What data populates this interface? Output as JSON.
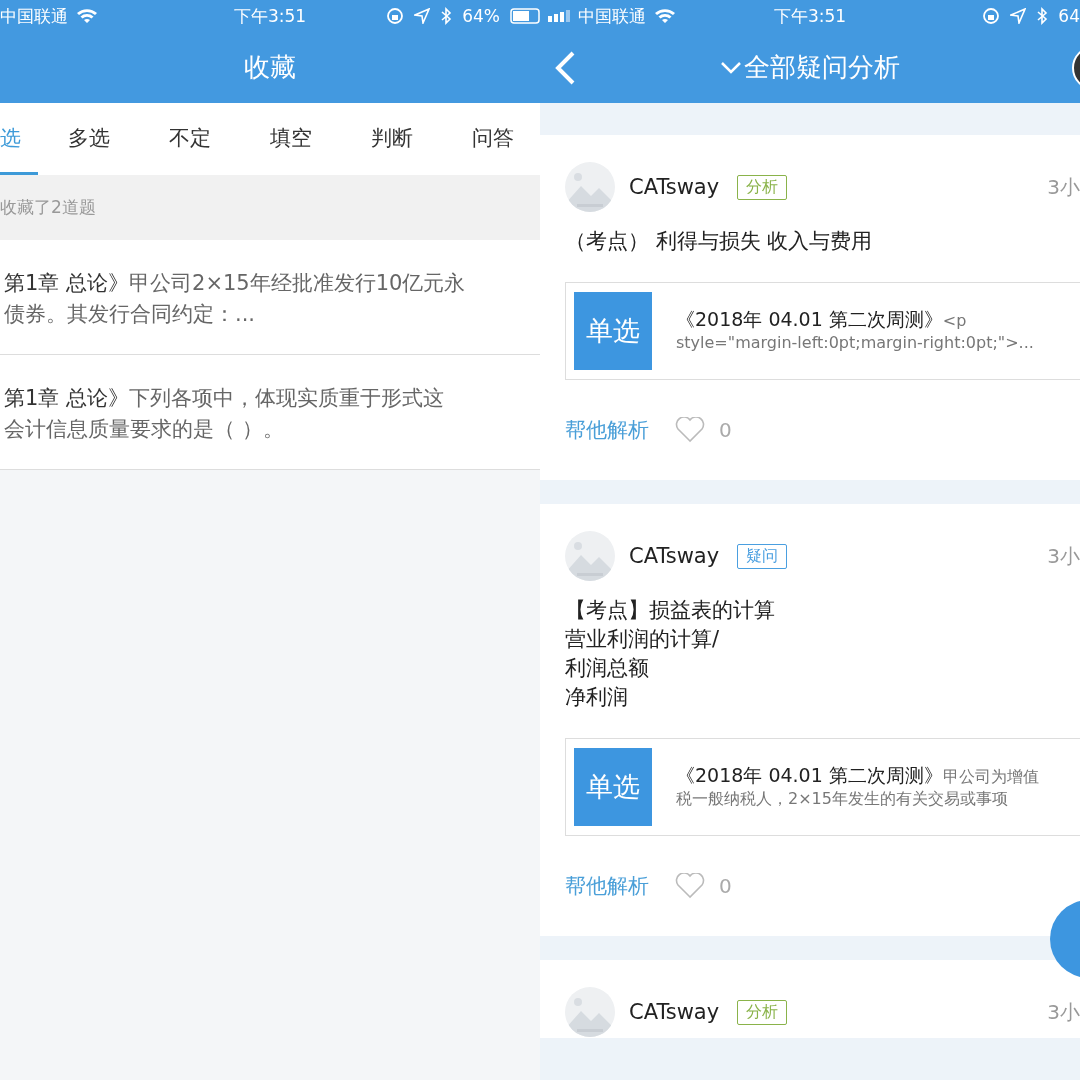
{
  "left": {
    "status_bar": {
      "carrier": "中国联通",
      "time": "下午3:51",
      "battery": "64%"
    },
    "title": "收藏",
    "tabs": [
      {
        "label": "选",
        "selected": true
      },
      {
        "label": "多选",
        "selected": false
      },
      {
        "label": "不定",
        "selected": false
      },
      {
        "label": "填空",
        "selected": false
      },
      {
        "label": "判断",
        "selected": false
      },
      {
        "label": "问答",
        "selected": false
      }
    ],
    "count": "收藏了2道题",
    "items": [
      {
        "chapter": "第1章 总论》",
        "lines": [
          "甲公司2×15年经批准发行10亿元永",
          "债券。其发行合同约定：..."
        ]
      },
      {
        "chapter": "第1章 总论》",
        "lines": [
          "下列各项中，体现实质重于形式这",
          "会计信息质量要求的是（ ）。"
        ]
      }
    ]
  },
  "right": {
    "status_bar": {
      "carrier": "中国联通",
      "time": "下午3:51",
      "battery": "64"
    },
    "title": "全部疑问分析",
    "posts": [
      {
        "author": "CATsway",
        "tag": "分析",
        "color": "#8ab34a",
        "time": "3小",
        "content": [
          "（考点） 利得与损失 收入与费用"
        ],
        "quote": {
          "type": "单选",
          "title": "《2018年 04.01 第二次周测》",
          "lines": [
            "<p",
            "style=\"margin-left:0pt;margin-right:0pt;\">..."
          ]
        },
        "action": "帮他解析",
        "likes": "0"
      },
      {
        "author": "CATsway",
        "tag": "疑问",
        "color": "#4a9fe0",
        "time": "3小",
        "content": [
          "【考点】损益表的计算",
          "营业利润的计算/",
          "利润总额",
          "净利润"
        ],
        "quote": {
          "type": "单选",
          "title": "《2018年 04.01 第二次周测》",
          "lines": [
            "甲公司为增值",
            "税一般纳税人，2×15年发生的有关交易或事项"
          ]
        },
        "action": "帮他解析",
        "likes": "0"
      },
      {
        "author": "CATsway",
        "tag": "分析",
        "color": "#8ab34a",
        "time": "3小"
      }
    ]
  }
}
